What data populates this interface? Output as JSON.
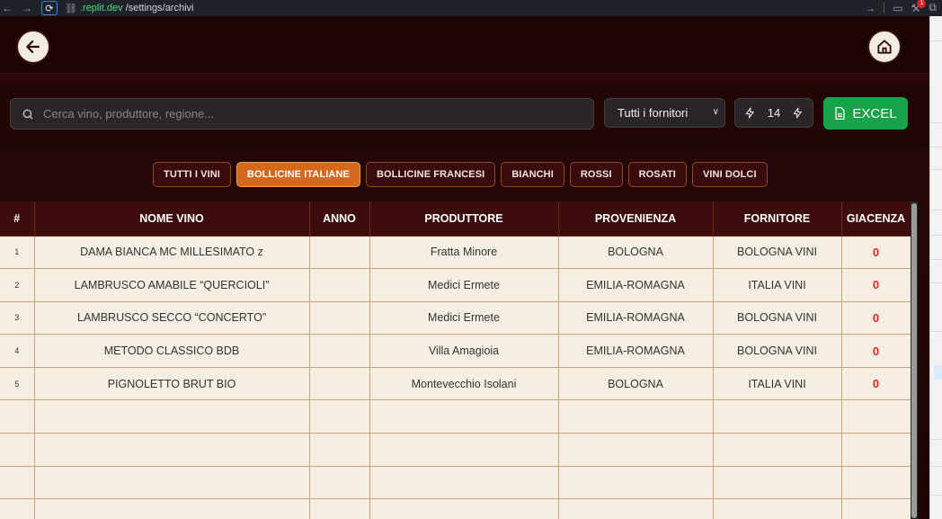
{
  "browser": {
    "url_domain": ".replit.dev",
    "url_path": "/settings/archivi",
    "notification_count": "1"
  },
  "search": {
    "placeholder": "Cerca vino, produttore, regione..."
  },
  "supplier_select": {
    "selected": "Tutti i fornitori"
  },
  "counter": {
    "value": "14"
  },
  "excel_button": {
    "label": "EXCEL",
    "color": "#16a34a"
  },
  "filters": [
    {
      "label": "TUTTI I VINI",
      "active": false
    },
    {
      "label": "BOLLICINE ITALIANE",
      "active": true
    },
    {
      "label": "BOLLICINE FRANCESI",
      "active": false
    },
    {
      "label": "BIANCHI",
      "active": false
    },
    {
      "label": "ROSSI",
      "active": false
    },
    {
      "label": "ROSATI",
      "active": false
    },
    {
      "label": "VINI DOLCI",
      "active": false
    }
  ],
  "table": {
    "headers": [
      "#",
      "NOME VINO",
      "ANNO",
      "PRODUTTORE",
      "PROVENIENZA",
      "FORNITORE",
      "GIACENZA"
    ],
    "rows": [
      {
        "idx": "1",
        "nome": "DAMA BIANCA MC MILLESIMATO z",
        "anno": "",
        "produttore": "Fratta Minore",
        "provenienza": "BOLOGNA",
        "fornitore": "BOLOGNA VINI",
        "giacenza": "0"
      },
      {
        "idx": "2",
        "nome": "LAMBRUSCO AMABILE “QUERCIOLI”",
        "anno": "",
        "produttore": "Medici Ermete",
        "provenienza": "EMILIA-ROMAGNA",
        "fornitore": "ITALIA VINI",
        "giacenza": "0"
      },
      {
        "idx": "3",
        "nome": "LAMBRUSCO SECCO “CONCERTO”",
        "anno": "",
        "produttore": "Medici Ermete",
        "provenienza": "EMILIA-ROMAGNA",
        "fornitore": "BOLOGNA VINI",
        "giacenza": "0"
      },
      {
        "idx": "4",
        "nome": "METODO CLASSICO BDB",
        "anno": "",
        "produttore": "Villa Amagioia",
        "provenienza": "EMILIA-ROMAGNA",
        "fornitore": "BOLOGNA VINI",
        "giacenza": "0"
      },
      {
        "idx": "5",
        "nome": "PIGNOLETTO BRUT BIO",
        "anno": "",
        "produttore": "Montevecchio Isolani",
        "provenienza": "BOLOGNA",
        "fornitore": "ITALIA VINI",
        "giacenza": "0"
      }
    ],
    "empty_rows": 4
  },
  "colors": {
    "accent": "#d2691e",
    "header_bg": "#3d0d0d",
    "row_bg": "#f5efe3",
    "stock_zero": "#dc2626"
  }
}
